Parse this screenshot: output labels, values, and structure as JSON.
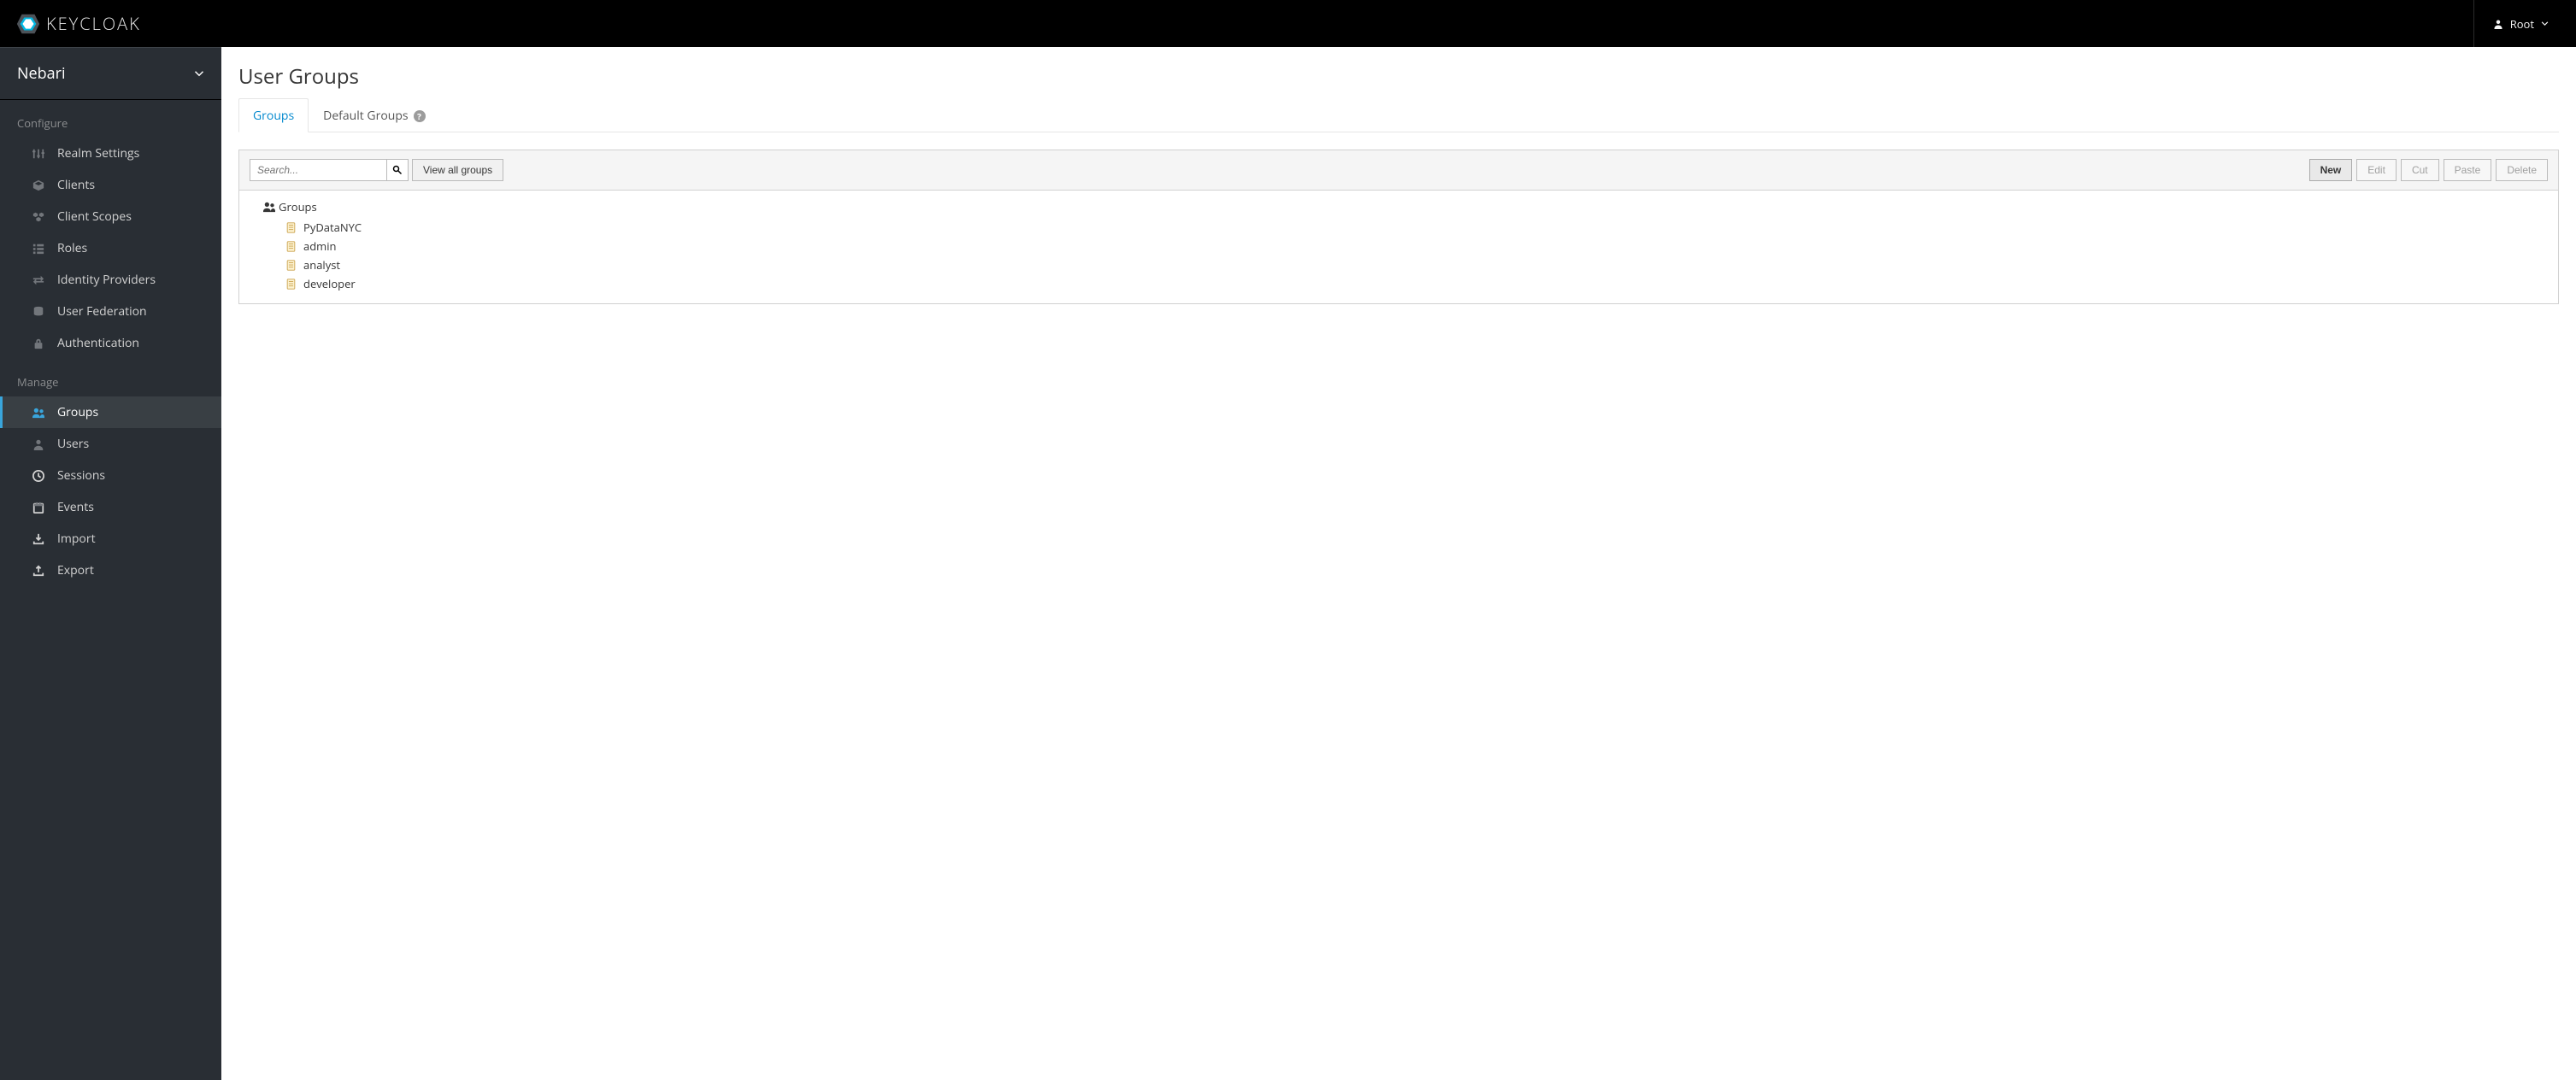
{
  "header": {
    "brand": "KEYCLOAK",
    "user": "Root"
  },
  "sidebar": {
    "realm": "Nebari",
    "sections": [
      {
        "label": "Configure",
        "items": [
          {
            "label": "Realm Settings",
            "icon": "sliders"
          },
          {
            "label": "Clients",
            "icon": "cube"
          },
          {
            "label": "Client Scopes",
            "icon": "cubes"
          },
          {
            "label": "Roles",
            "icon": "list"
          },
          {
            "label": "Identity Providers",
            "icon": "exchange"
          },
          {
            "label": "User Federation",
            "icon": "database"
          },
          {
            "label": "Authentication",
            "icon": "lock"
          }
        ]
      },
      {
        "label": "Manage",
        "items": [
          {
            "label": "Groups",
            "icon": "users",
            "active": true
          },
          {
            "label": "Users",
            "icon": "user"
          },
          {
            "label": "Sessions",
            "icon": "clock"
          },
          {
            "label": "Events",
            "icon": "calendar"
          },
          {
            "label": "Import",
            "icon": "import"
          },
          {
            "label": "Export",
            "icon": "export"
          }
        ]
      }
    ]
  },
  "main": {
    "title": "User Groups",
    "tabs": [
      {
        "label": "Groups",
        "active": true
      },
      {
        "label": "Default Groups",
        "active": false,
        "help": true
      }
    ],
    "search": {
      "placeholder": "Search..."
    },
    "buttons": {
      "view_all": "View all groups",
      "new": "New",
      "edit": "Edit",
      "cut": "Cut",
      "paste": "Paste",
      "delete": "Delete"
    },
    "tree": {
      "root": "Groups",
      "nodes": [
        {
          "label": "PyDataNYC"
        },
        {
          "label": "admin"
        },
        {
          "label": "analyst"
        },
        {
          "label": "developer"
        }
      ]
    }
  }
}
